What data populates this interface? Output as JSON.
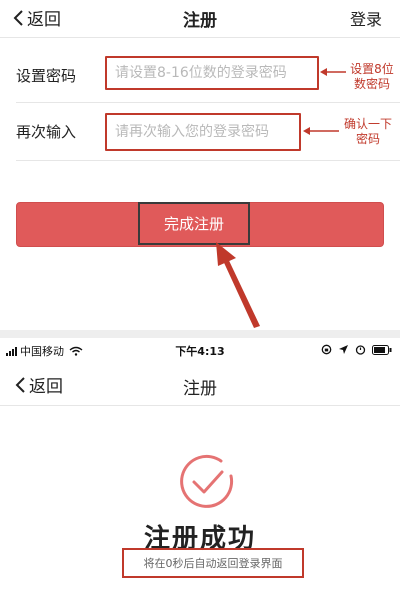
{
  "register_form": {
    "back_label": "返回",
    "title": "注册",
    "login_link": "登录",
    "password_label": "设置密码",
    "password_placeholder": "请设置8-16位数的登录密码",
    "password_note_line1": "设置8位",
    "password_note_line2": "数密码",
    "confirm_label": "再次输入",
    "confirm_placeholder": "请再次输入您的登录密码",
    "confirm_note_line1": "确认一下",
    "confirm_note_line2": "密码",
    "submit_label": "完成注册"
  },
  "success_screen": {
    "status_bar": {
      "carrier": "中国移动",
      "time": "下午4:13"
    },
    "back_label": "返回",
    "title": "注册",
    "success_title": "注册成功",
    "redirect_hint": "将在0秒后自动返回登录界面"
  },
  "colors": {
    "annotation_red": "#c0392b",
    "submit_button": "#e05a5a",
    "success_circle": "#e57373"
  }
}
